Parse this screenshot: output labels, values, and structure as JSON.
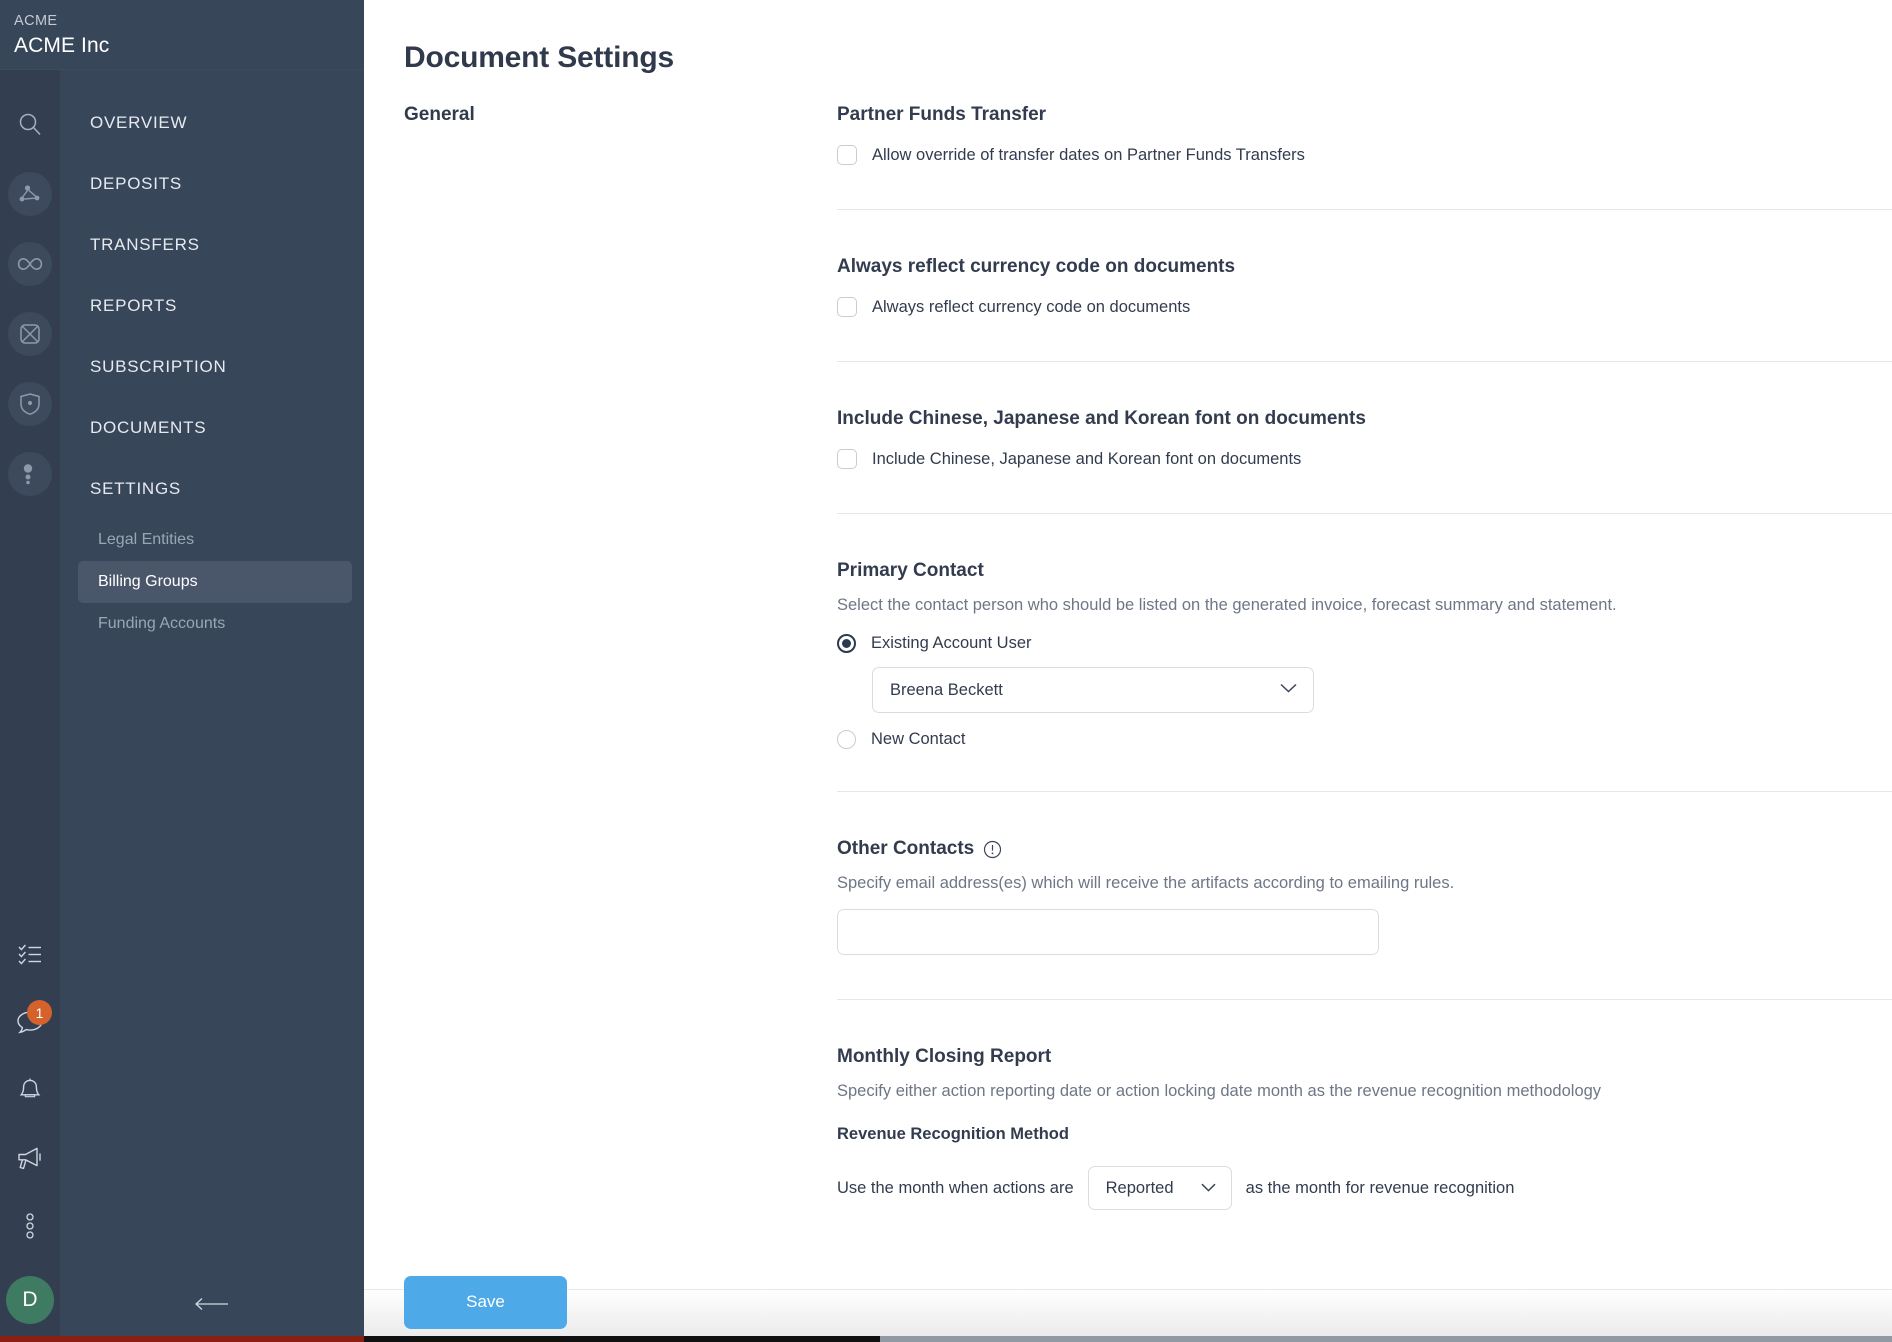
{
  "sidebar": {
    "org_kicker": "ACME",
    "org_name": "ACME Inc",
    "rail_icons": [
      {
        "name": "search-icon"
      },
      {
        "name": "network-icon"
      },
      {
        "name": "infinity-icon"
      },
      {
        "name": "atom-icon"
      },
      {
        "name": "shield-icon"
      },
      {
        "name": "more-dots-icon"
      }
    ],
    "rail_bottom": [
      {
        "name": "checklist-icon"
      },
      {
        "name": "chat-icon",
        "badge": "1"
      },
      {
        "name": "bell-icon"
      },
      {
        "name": "megaphone-icon"
      },
      {
        "name": "dots-vertical-icon"
      }
    ],
    "avatar_initial": "D",
    "nav": [
      {
        "label": "OVERVIEW"
      },
      {
        "label": "DEPOSITS"
      },
      {
        "label": "TRANSFERS"
      },
      {
        "label": "REPORTS"
      },
      {
        "label": "SUBSCRIPTION"
      },
      {
        "label": "DOCUMENTS"
      },
      {
        "label": "SETTINGS"
      }
    ],
    "subnav": [
      {
        "label": "Legal Entities",
        "active": false
      },
      {
        "label": "Billing Groups",
        "active": true
      },
      {
        "label": "Funding Accounts",
        "active": false
      }
    ]
  },
  "main": {
    "page_title": "Document Settings",
    "section_label": "General",
    "blocks": {
      "partner_funds": {
        "title": "Partner Funds Transfer",
        "checkbox_label": "Allow override of transfer dates on Partner Funds Transfers",
        "checked": false
      },
      "currency_code": {
        "title": "Always reflect currency code on documents",
        "checkbox_label": "Always reflect currency code on documents",
        "checked": false
      },
      "cjk_font": {
        "title": "Include Chinese, Japanese and Korean font on documents",
        "checkbox_label": "Include Chinese, Japanese and Korean font on documents",
        "checked": false
      },
      "primary_contact": {
        "title": "Primary Contact",
        "description": "Select the contact person who should be listed on the generated invoice, forecast summary and statement.",
        "radio_existing": "Existing Account User",
        "radio_new": "New Contact",
        "selected": "existing",
        "select_value": "Breena Beckett"
      },
      "other_contacts": {
        "title": "Other Contacts",
        "warning_icon": "exclamation-circle-icon",
        "description": "Specify email address(es) which will receive the artifacts according to emailing rules.",
        "input_value": "",
        "input_placeholder": ""
      },
      "monthly_closing": {
        "title": "Monthly Closing Report",
        "description": "Specify either action reporting date or action locking date month as the revenue recognition methodology",
        "sub_label": "Revenue Recognition Method",
        "prefix_text": "Use the month when actions are",
        "select_value": "Reported",
        "suffix_text": "as the month for revenue recognition"
      }
    }
  },
  "footer": {
    "save_label": "Save"
  },
  "colors": {
    "sidebar_bg": "#38465a",
    "rail_bg": "#333f51",
    "active_nav": "#4a566a",
    "accent_blue": "#4ea9e8",
    "badge_orange": "#d4622a",
    "avatar_green": "#3f7a62",
    "heading": "#303a4c",
    "muted_text": "#6d7786"
  }
}
